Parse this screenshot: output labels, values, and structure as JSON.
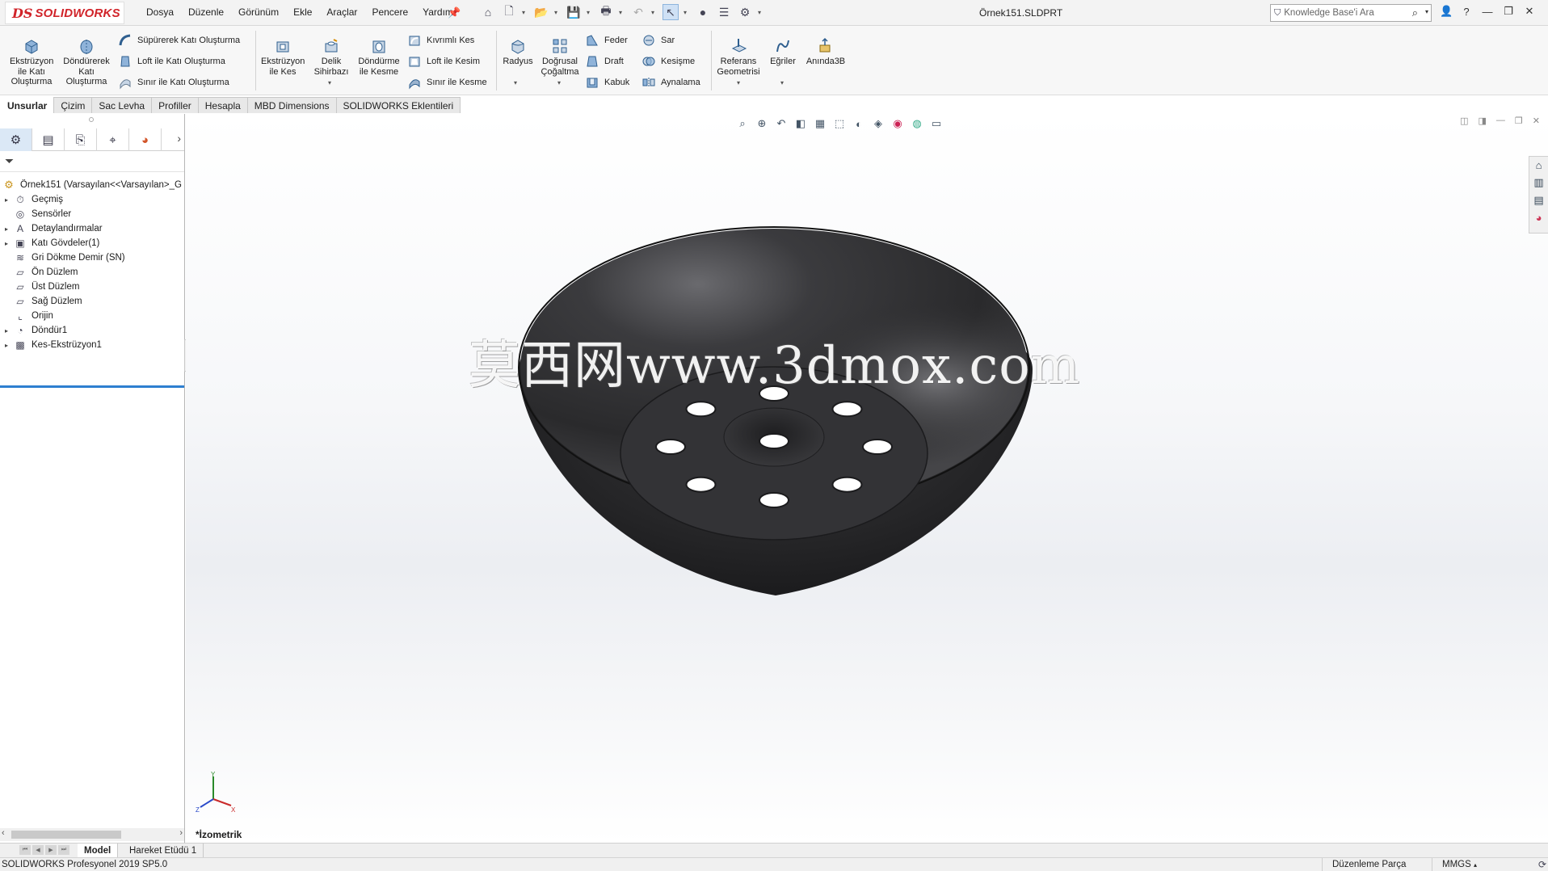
{
  "app": {
    "logo_ds": "DS",
    "logo_name": "SOLIDWORKS",
    "document_title": "Örnek151.SLDPRT"
  },
  "menu": [
    "Dosya",
    "Düzenle",
    "Görünüm",
    "Ekle",
    "Araçlar",
    "Pencere",
    "Yardım"
  ],
  "search": {
    "placeholder": "Knowledge Base'i Ara"
  },
  "ribbon": {
    "extrude_boss": "Ekstrüzyon ile Katı Oluşturma",
    "revolve_boss": "Döndürerek Katı Oluşturma",
    "sweep_boss": "Süpürerek Katı Oluşturma",
    "loft_boss": "Loft ile Katı Oluşturma",
    "boundary_boss": "Sınır ile Katı Oluşturma",
    "extrude_cut": "Ekstrüzyon ile Kes",
    "hole_wizard": "Delik Sihirbazı",
    "revolve_cut": "Döndürme ile Kesme",
    "swept_cut": "Kıvrımlı Kes",
    "loft_cut": "Loft ile Kesim",
    "boundary_cut": "Sınır ile Kesme",
    "fillet": "Radyus",
    "linear_pattern": "Doğrusal Çoğaltma",
    "rib": "Feder",
    "draft": "Draft",
    "shell": "Kabuk",
    "wrap": "Sar",
    "intersect": "Kesişme",
    "mirror": "Aynalama",
    "ref_geometry": "Referans Geometrisi",
    "curves": "Eğriler",
    "instant3d": "Anında3B"
  },
  "tabs": [
    "Unsurlar",
    "Çizim",
    "Sac Levha",
    "Profiller",
    "Hesapla",
    "MBD Dimensions",
    "SOLIDWORKS Eklentileri"
  ],
  "tree": {
    "root": "Örnek151  (Varsayılan<<Varsayılan>_G",
    "items": [
      {
        "label": "Geçmiş",
        "expandable": true,
        "icon": "history-icon"
      },
      {
        "label": "Sensörler",
        "expandable": false,
        "icon": "sensor-icon"
      },
      {
        "label": "Detaylandırmalar",
        "expandable": true,
        "icon": "annotations-icon"
      },
      {
        "label": "Katı Gövdeler(1)",
        "expandable": true,
        "icon": "solid-bodies-icon"
      },
      {
        "label": "Gri Dökme Demir (SN)",
        "expandable": false,
        "icon": "material-icon"
      },
      {
        "label": "Ön Düzlem",
        "expandable": false,
        "icon": "plane-icon"
      },
      {
        "label": "Üst Düzlem",
        "expandable": false,
        "icon": "plane-icon"
      },
      {
        "label": "Sağ Düzlem",
        "expandable": false,
        "icon": "plane-icon"
      },
      {
        "label": "Orijin",
        "expandable": false,
        "icon": "origin-icon"
      },
      {
        "label": "Döndür1",
        "expandable": true,
        "icon": "revolve-feature-icon"
      },
      {
        "label": "Kes-Ekstrüzyon1",
        "expandable": true,
        "icon": "cut-extrude-feature-icon"
      }
    ]
  },
  "viewport": {
    "watermark": "莫西网www.3dmox.com",
    "view_name": "*İzometrik",
    "triad_axes": [
      "Y",
      "Z",
      "X"
    ]
  },
  "bottom_tabs": [
    "Model",
    "Hareket Etüdü 1"
  ],
  "status": {
    "version": "SOLIDWORKS Profesyonel 2019 SP5.0",
    "mode": "Düzenleme Parça",
    "units": "MMGS"
  },
  "colors": {
    "brand": "#d1242a",
    "accent": "#2e7fd0",
    "model": "#2b2b2d"
  }
}
